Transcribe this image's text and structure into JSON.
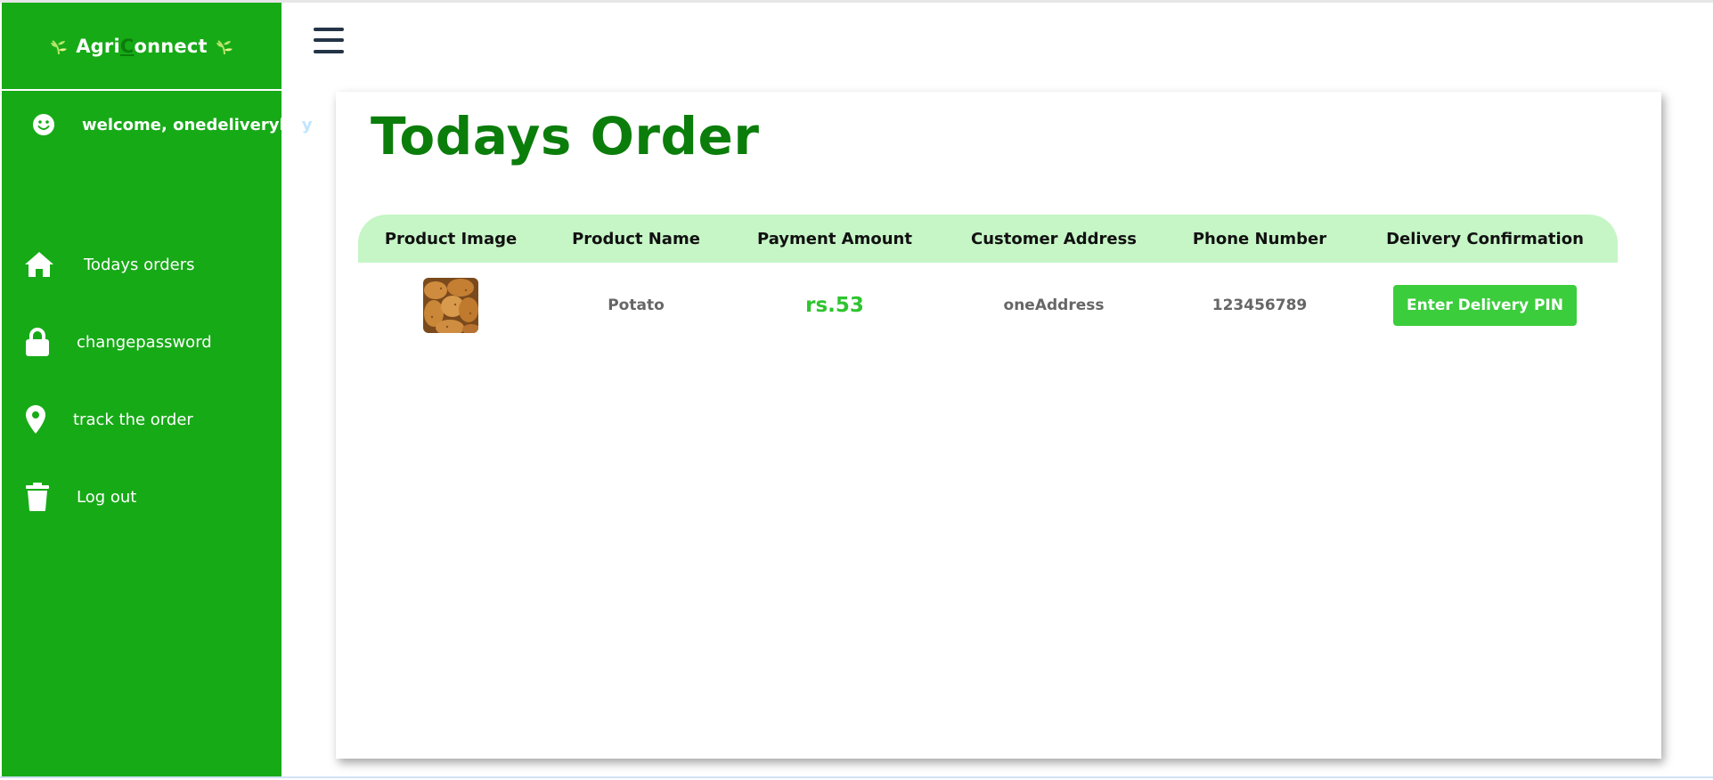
{
  "sidebar": {
    "brand": {
      "prefix": "Agri",
      "highlight": "C",
      "suffix": "onnect",
      "leaf_icon": "leaf-icon"
    },
    "welcome": {
      "text": "welcome, onedeliverybo",
      "faded": "y",
      "icon": "smile-icon"
    },
    "items": [
      {
        "label": "Todays orders",
        "icon": "home-icon"
      },
      {
        "label": "changepassword",
        "icon": "lock-icon"
      },
      {
        "label": "track the order",
        "icon": "map-pin-icon"
      },
      {
        "label": "Log out",
        "icon": "trash-icon"
      }
    ]
  },
  "header": {
    "menu_icon": "hamburger-menu-icon"
  },
  "main": {
    "title": "Todays Order",
    "table": {
      "columns": [
        "Product Image",
        "Product Name",
        "Payment Amount",
        "Customer Address",
        "Phone Number",
        "Delivery Confirmation"
      ],
      "rows": [
        {
          "image": "potato-image",
          "product_name": "Potato",
          "payment_amount": "rs.53",
          "customer_address": "oneAddress",
          "phone_number": "123456789",
          "action_label": "Enter Delivery PIN"
        }
      ]
    }
  },
  "colors": {
    "sidebar_bg": "#17aa17",
    "title": "#0b7d0b",
    "table_header_bg": "#c6f5c6",
    "amount": "#2fc42f",
    "button_bg": "#3ccd3c",
    "hamburger": "#243447"
  }
}
